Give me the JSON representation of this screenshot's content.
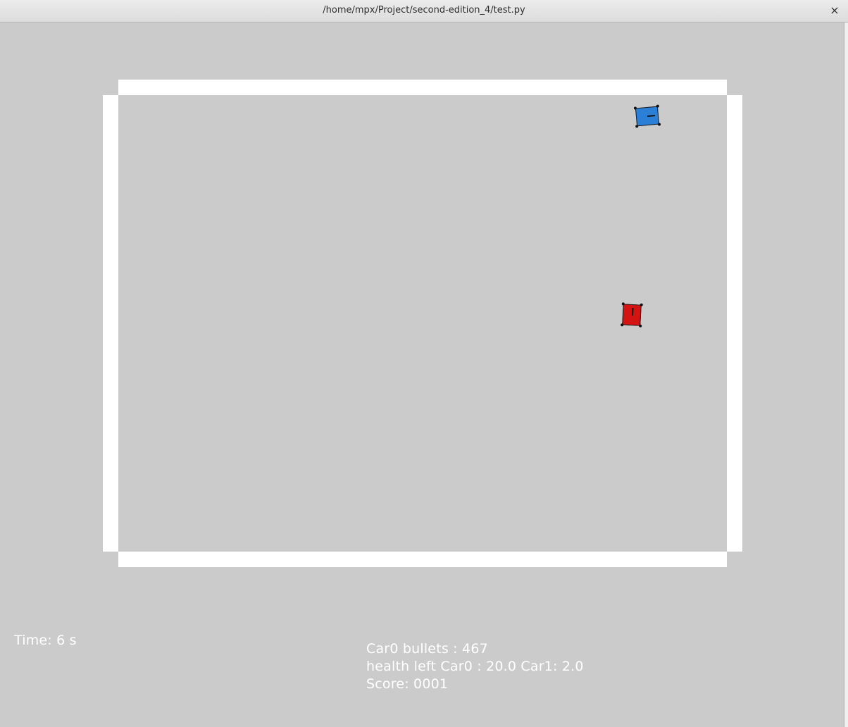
{
  "window": {
    "title": "/home/mpx/Project/second-edition_4/test.py",
    "close_glyph": "×"
  },
  "game": {
    "background_color": "#cbcbcc",
    "wall_color": "#ffffff",
    "cars": [
      {
        "name": "Car0",
        "color": "#2b7fd6"
      },
      {
        "name": "Car1",
        "color": "#d41313"
      }
    ]
  },
  "hud": {
    "time": "Time: 6 s",
    "bullets": "Car0 bullets : 467",
    "health": "health left Car0 : 20.0 Car1: 2.0",
    "score": "Score: 0001"
  }
}
